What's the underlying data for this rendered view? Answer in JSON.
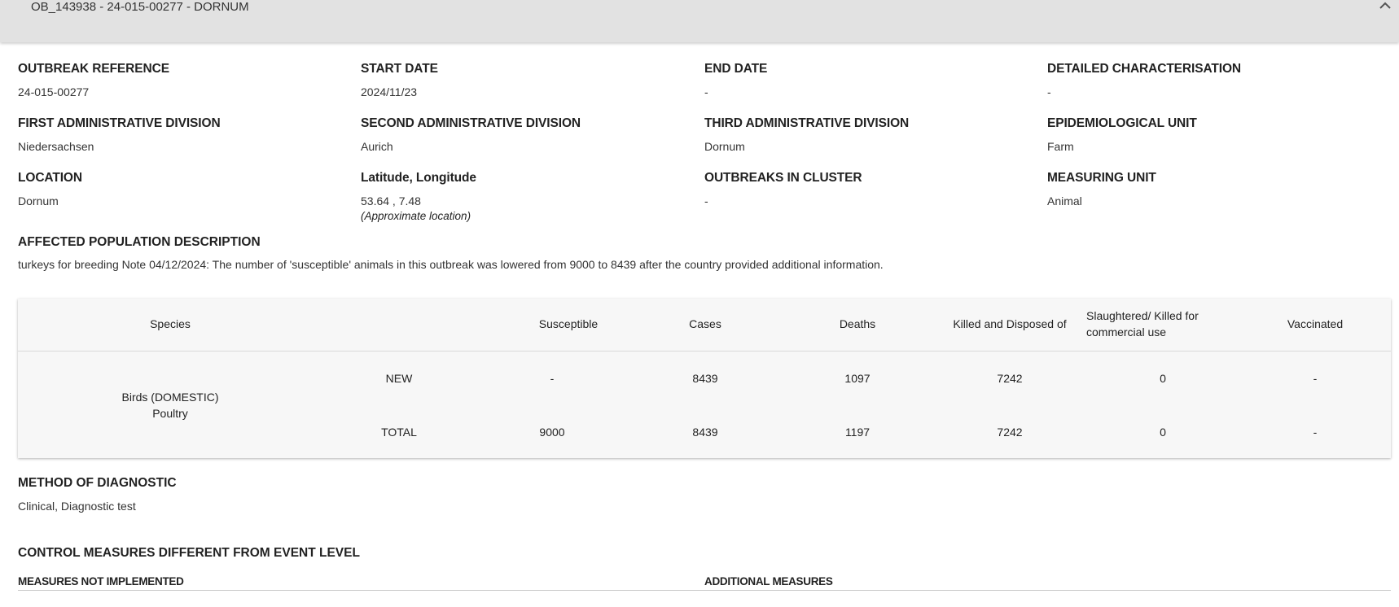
{
  "panel": {
    "title": "OB_143938 - 24-015-00277 - DORNUM"
  },
  "fields": {
    "outbreak_reference": {
      "label": "OUTBREAK REFERENCE",
      "value": "24-015-00277"
    },
    "start_date": {
      "label": "START DATE",
      "value": "2024/11/23"
    },
    "end_date": {
      "label": "END DATE",
      "value": "-"
    },
    "detailed_characterisation": {
      "label": "DETAILED CHARACTERISATION",
      "value": "-"
    },
    "first_admin": {
      "label": "FIRST ADMINISTRATIVE DIVISION",
      "value": "Niedersachsen"
    },
    "second_admin": {
      "label": "SECOND ADMINISTRATIVE DIVISION",
      "value": "Aurich"
    },
    "third_admin": {
      "label": "THIRD ADMINISTRATIVE DIVISION",
      "value": "Dornum"
    },
    "epi_unit": {
      "label": "EPIDEMIOLOGICAL UNIT",
      "value": "Farm"
    },
    "location": {
      "label": "LOCATION",
      "value": "Dornum"
    },
    "lat_long": {
      "label": "Latitude, Longitude",
      "value": "53.64 , 7.48",
      "note": "(Approximate location)"
    },
    "outbreaks_in_cluster": {
      "label": "OUTBREAKS IN CLUSTER",
      "value": "-"
    },
    "measuring_unit": {
      "label": "MEASURING UNIT",
      "value": "Animal"
    }
  },
  "affected_population": {
    "label": "AFFECTED POPULATION DESCRIPTION",
    "value": "turkeys for breeding Note 04/12/2024: The number of 'susceptible' animals in this outbreak was lowered from 9000 to 8439 after the country provided additional information."
  },
  "table": {
    "headers": {
      "species": "Species",
      "susceptible": "Susceptible",
      "cases": "Cases",
      "deaths": "Deaths",
      "killed": "Killed and Disposed of",
      "slaughtered": "Slaughtered/ Killed for commercial use",
      "vaccinated": "Vaccinated"
    },
    "species_line1": "Birds (DOMESTIC)",
    "species_line2": "Poultry",
    "rows": [
      {
        "type": "NEW",
        "susceptible": "-",
        "cases": "8439",
        "deaths": "1097",
        "killed": "7242",
        "slaughtered": "0",
        "vaccinated": "-"
      },
      {
        "type": "TOTAL",
        "susceptible": "9000",
        "cases": "8439",
        "deaths": "1197",
        "killed": "7242",
        "slaughtered": "0",
        "vaccinated": "-"
      }
    ]
  },
  "method_of_diagnostic": {
    "label": "METHOD OF DIAGNOSTIC",
    "value": "Clinical, Diagnostic test"
  },
  "control_measures": {
    "label": "CONTROL MEASURES DIFFERENT FROM EVENT LEVEL",
    "not_implemented": "MEASURES NOT IMPLEMENTED",
    "additional": "ADDITIONAL MEASURES"
  },
  "icons": {
    "collapse": "chevron-up-icon"
  }
}
